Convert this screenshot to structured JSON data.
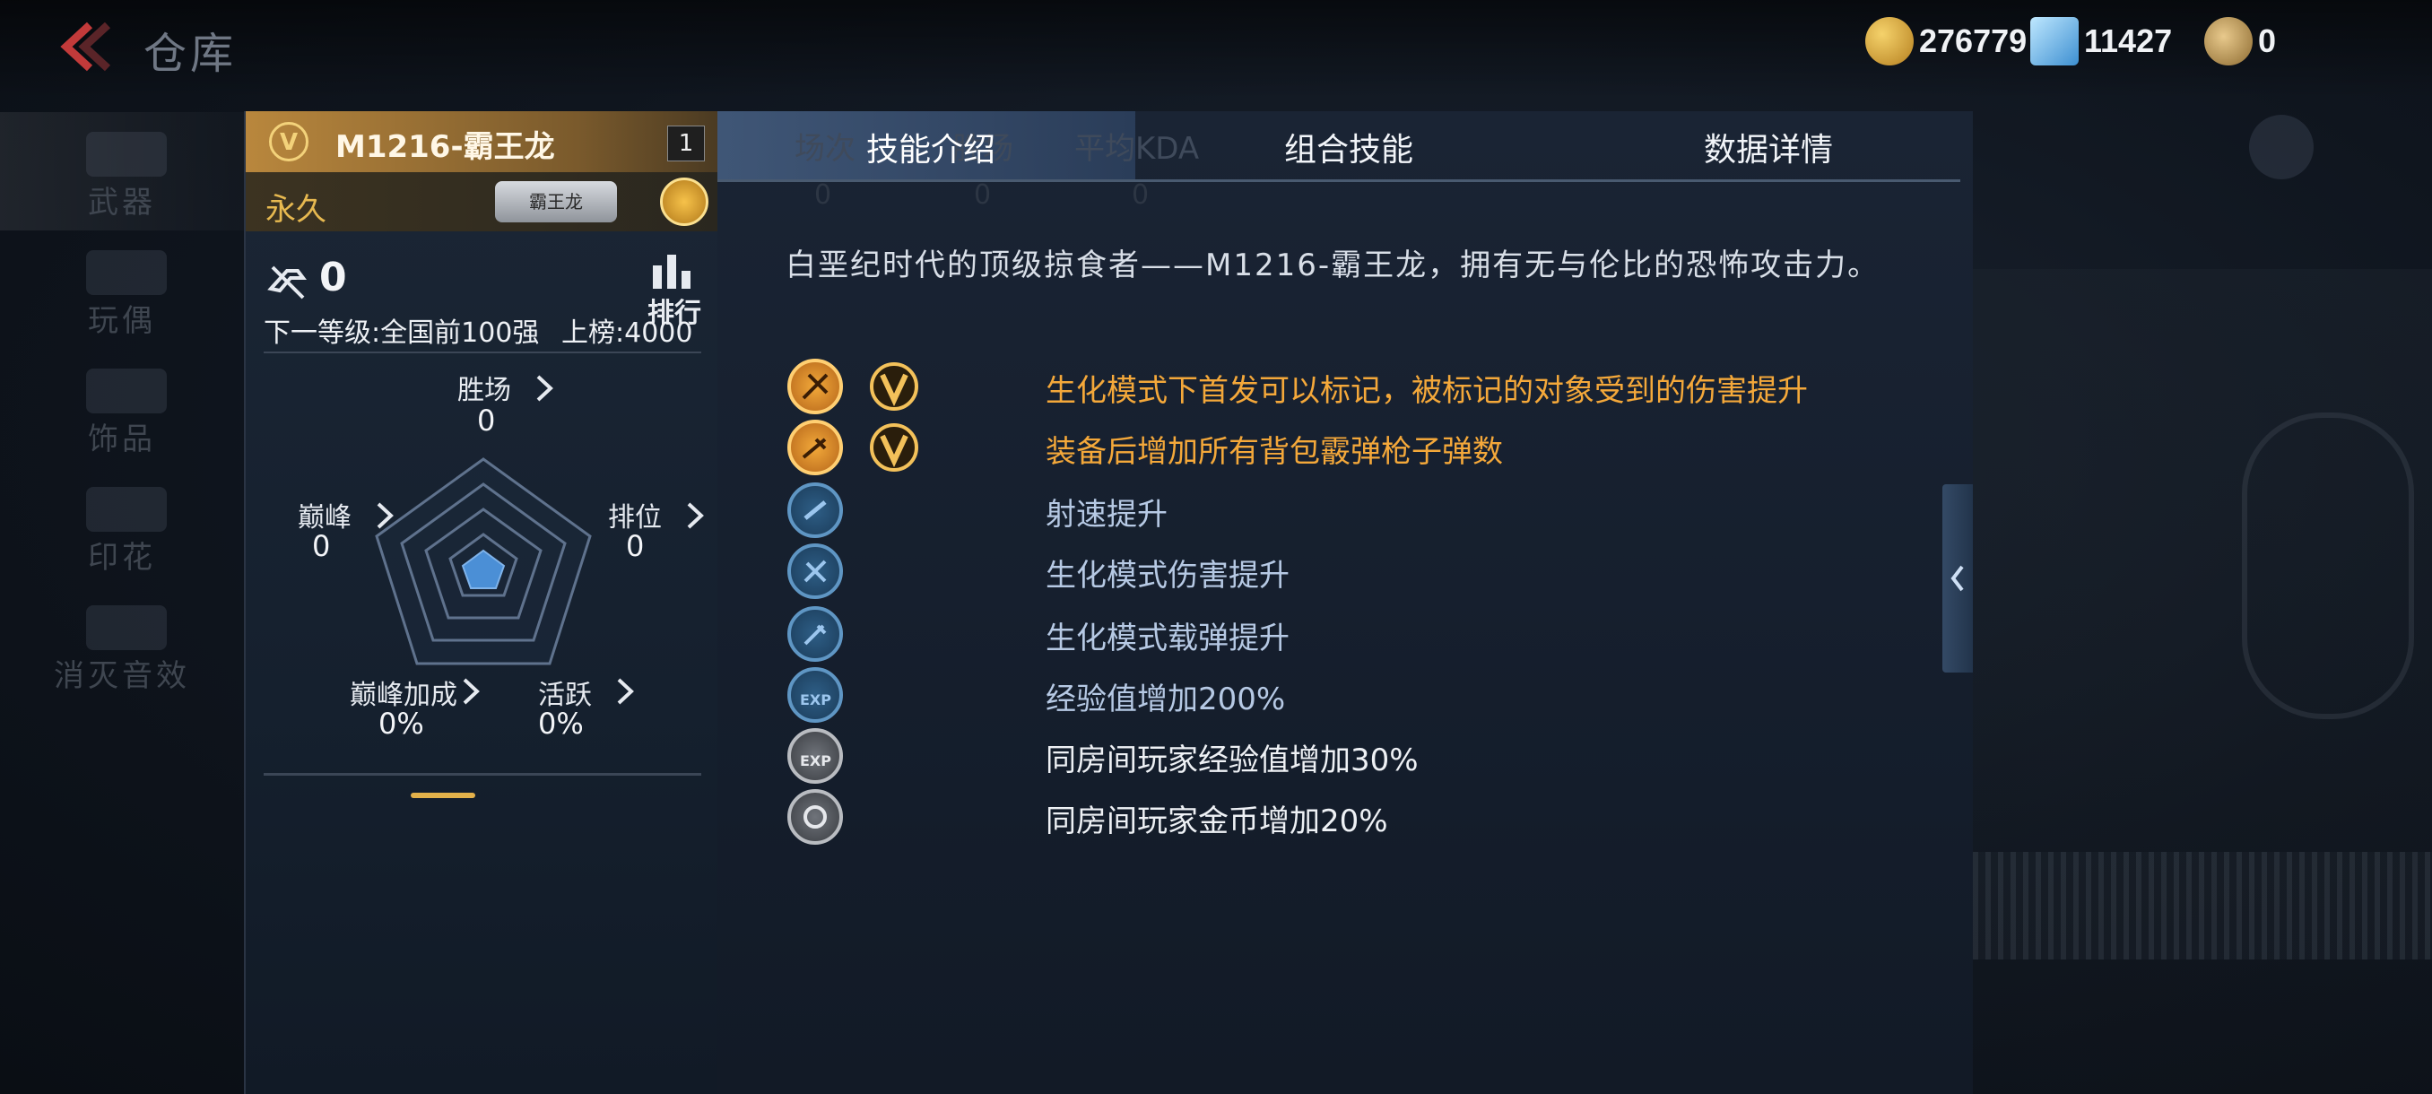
{
  "header": {
    "title": "仓库",
    "gold": "276779",
    "diamonds": "11427",
    "tickets": "0"
  },
  "sidebar": {
    "items": [
      {
        "label": "武器",
        "active": true
      },
      {
        "label": "玩偶",
        "active": false
      },
      {
        "label": "饰品",
        "active": false
      },
      {
        "label": "印花",
        "active": false
      },
      {
        "label": "消灭音效",
        "active": false
      }
    ]
  },
  "card": {
    "badge": "V",
    "name": "M1216-霸王龙",
    "level": "1",
    "duration": "永久",
    "nameplate": "霸王龙",
    "kills": "0",
    "rank_label": "排行",
    "next_level": "下一等级:全国前100强",
    "on_board": "上榜:4000",
    "stats": {
      "wins": {
        "label": "胜场",
        "value": "0"
      },
      "peak": {
        "label": "巅峰",
        "value": "0"
      },
      "ranked": {
        "label": "排位",
        "value": "0"
      },
      "peak_bonus": {
        "label": "巅峰加成",
        "value": "0%"
      },
      "active": {
        "label": "活跃",
        "value": "0%"
      }
    }
  },
  "panel": {
    "tabs": [
      {
        "label": "技能介绍",
        "active": true
      },
      {
        "label": "组合技能",
        "active": false
      },
      {
        "label": "数据详情",
        "active": false
      }
    ],
    "ghost_tabs": [
      "场次",
      "胜场",
      "平均KDA"
    ],
    "ghost_values": [
      "0",
      "0",
      "0"
    ],
    "description": "白垩纪时代的顶级掠食者——M1216-霸王龙，拥有无与伦比的恐怖攻击力。",
    "skills": [
      {
        "icon": "biochem-mark-icon",
        "tier": "orange",
        "vip": true,
        "text": "生化模式下首发可以标记，被标记的对象受到的伤害提升"
      },
      {
        "icon": "shotgun-ammo-icon",
        "tier": "orange",
        "vip": true,
        "text": "装备后增加所有背包霰弹枪子弹数"
      },
      {
        "icon": "fire-rate-icon",
        "tier": "blue",
        "vip": false,
        "text": "射速提升"
      },
      {
        "icon": "biochem-damage-icon",
        "tier": "blue",
        "vip": false,
        "text": "生化模式伤害提升"
      },
      {
        "icon": "biochem-ammo-icon",
        "tier": "blue",
        "vip": false,
        "text": "生化模式载弹提升"
      },
      {
        "icon": "exp-icon",
        "tier": "blue",
        "vip": false,
        "text": "经验值增加200%"
      },
      {
        "icon": "room-exp-icon",
        "tier": "gray",
        "vip": false,
        "text": "同房间玩家经验值增加30%"
      },
      {
        "icon": "room-gold-icon",
        "tier": "gray",
        "vip": false,
        "text": "同房间玩家金币增加20%"
      }
    ]
  },
  "colors": {
    "accent_gold": "#e3b14a",
    "skill_orange": "#f4a83a",
    "skill_blue": "#b6c9e4",
    "tab_active_bg": "#3f5a80"
  }
}
